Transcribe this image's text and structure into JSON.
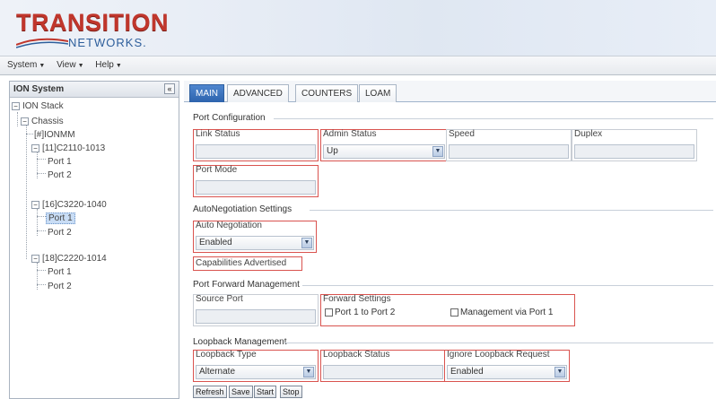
{
  "header": {
    "logo_top": "TRANSITION",
    "logo_bottom": "NETWORKS.",
    "brand_red": "#c0362c",
    "brand_blue": "#2d5e9b"
  },
  "menubar": {
    "items": [
      {
        "label": "System"
      },
      {
        "label": "View"
      },
      {
        "label": "Help"
      }
    ]
  },
  "tree": {
    "title": "ION System",
    "collapse_icon": "collapse-icon",
    "nodes": [
      {
        "label": "ION Stack",
        "toggle": "−"
      },
      {
        "label": "Chassis",
        "toggle": "−"
      },
      {
        "label": "[#]IONMM"
      },
      {
        "label": "[11]C2110-1013",
        "toggle": "−"
      },
      {
        "label": "Port 1"
      },
      {
        "label": "Port 2"
      },
      {
        "label": "[16]C3220-1040",
        "toggle": "−"
      },
      {
        "label": "Port 1",
        "selected": true
      },
      {
        "label": "Port 2"
      },
      {
        "label": "[18]C2220-1014",
        "toggle": "−"
      },
      {
        "label": "Port 1"
      },
      {
        "label": "Port 2"
      }
    ]
  },
  "tabs": [
    {
      "label": "MAIN",
      "active": true
    },
    {
      "label": "ADVANCED"
    },
    {
      "label": "COUNTERS"
    },
    {
      "label": "LOAM"
    }
  ],
  "port_config": {
    "title": "Port Configuration",
    "link_status": {
      "label": "Link Status",
      "value": ""
    },
    "admin_status": {
      "label": "Admin Status",
      "value": "Up"
    },
    "speed": {
      "label": "Speed",
      "value": ""
    },
    "duplex": {
      "label": "Duplex",
      "value": ""
    },
    "port_mode": {
      "label": "Port Mode",
      "value": ""
    }
  },
  "auto_neg": {
    "title": "AutoNegotiation Settings",
    "auto_negotiation": {
      "label": "Auto Negotiation",
      "value": "Enabled"
    },
    "capabilities": {
      "label": "Capabilities Advertised"
    }
  },
  "port_forward": {
    "title": "Port Forward Management",
    "source_port": {
      "label": "Source Port",
      "value": ""
    },
    "forward_settings": {
      "label": "Forward Settings",
      "opt1": "Port 1 to Port 2",
      "opt2": "Management via Port 1"
    }
  },
  "loopback": {
    "title": "Loopback Management",
    "type": {
      "label": "Loopback Type",
      "value": "Alternate"
    },
    "status": {
      "label": "Loopback Status",
      "value": ""
    },
    "ignore_request": {
      "label": "Ignore Loopback Request",
      "value": "Enabled"
    }
  },
  "buttons": {
    "refresh": "Refresh",
    "save": "Save",
    "start": "Start",
    "stop": "Stop"
  }
}
